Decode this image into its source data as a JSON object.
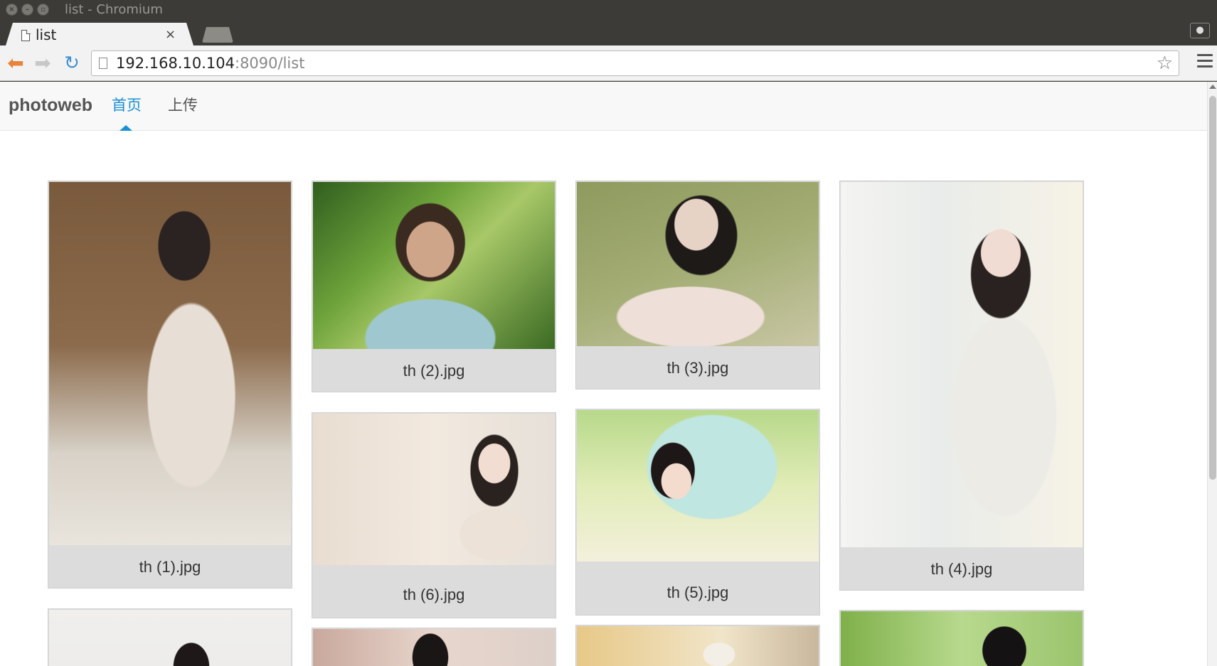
{
  "window": {
    "title": "list - Chromium"
  },
  "tabs": [
    {
      "label": "list",
      "close": "×"
    }
  ],
  "toolbar": {
    "url_host": "192.168.10.104",
    "url_rest": ":8090/list"
  },
  "site": {
    "brand": "photoweb",
    "nav": [
      {
        "label": "首页",
        "active": true
      },
      {
        "label": "上传",
        "active": false
      }
    ],
    "accent_color": "#1a8fd4"
  },
  "photos": [
    {
      "caption": "th (1).jpg"
    },
    {
      "caption": "th (2).jpg"
    },
    {
      "caption": "th (3).jpg"
    },
    {
      "caption": "th (4).jpg"
    },
    {
      "caption": "th (6).jpg"
    },
    {
      "caption": "th (5).jpg"
    }
  ]
}
